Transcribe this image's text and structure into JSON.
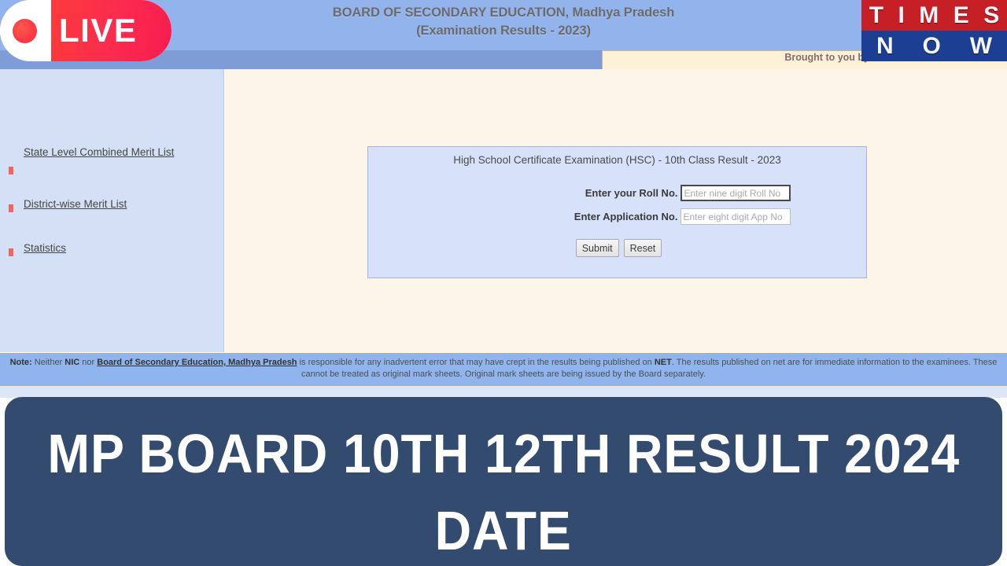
{
  "header": {
    "title_line1": "BOARD OF SECONDARY EDUCATION, Madhya Pradesh",
    "title_line2": "(Examination Results - 2023)",
    "brought_by": "Brought to you by",
    "live_badge_label": "LIVE",
    "logo": {
      "top_word": "TIMES",
      "bottom_word": "NOW",
      "top_letters": [
        "T",
        "I",
        "M",
        "E",
        "S"
      ],
      "bottom_letters": [
        "N",
        "O",
        "W"
      ],
      "top_color": "#c62026",
      "bottom_color": "#1c3f94"
    }
  },
  "sidebar": {
    "items": [
      {
        "label": "State Level Combined Merit List"
      },
      {
        "label": "District-wise Merit List"
      },
      {
        "label": "Statistics"
      }
    ]
  },
  "result_form": {
    "title": "High School Certificate Examination (HSC) - 10th Class Result - 2023",
    "fields": [
      {
        "label": "Enter your Roll No.",
        "placeholder": "Enter nine digit Roll No",
        "value": "",
        "focused": true
      },
      {
        "label": "Enter Application No.",
        "placeholder": "Enter eight digit App No",
        "value": "",
        "focused": false
      }
    ],
    "submit_label": "Submit",
    "reset_label": "Reset"
  },
  "note": {
    "prefix": "Note:",
    "text_1": " Neither ",
    "bold_1": "NIC",
    "text_2": " nor ",
    "link_1": "Board of Secondary Education, Madhya Pradesh",
    "text_3": " is responsible for any inadvertent error that may have crept in the results being published on ",
    "bold_2": "NET",
    "text_4": ". The results published on net are for immediate information to the examinees. These cannot be treated as original mark sheets. Original mark sheets are being issued by the Board separately."
  },
  "banner": {
    "line1": "MP BOARD 10TH 12TH RESULT 2024",
    "line2": "DATE",
    "background": "#344b70",
    "text_color": "#ffffff"
  },
  "colors": {
    "header_blue": "#92b3ec",
    "header_subband": "#7e9dd6",
    "sidebar_blue": "#d4e0f6",
    "main_cream": "#fdf5e7",
    "panel_blue": "#d7e1fa",
    "panel_border": "#a7b1e6",
    "note_blue": "#8fb4ee",
    "bullet_red": "#f0665f",
    "live_red": "#f81d4f"
  }
}
